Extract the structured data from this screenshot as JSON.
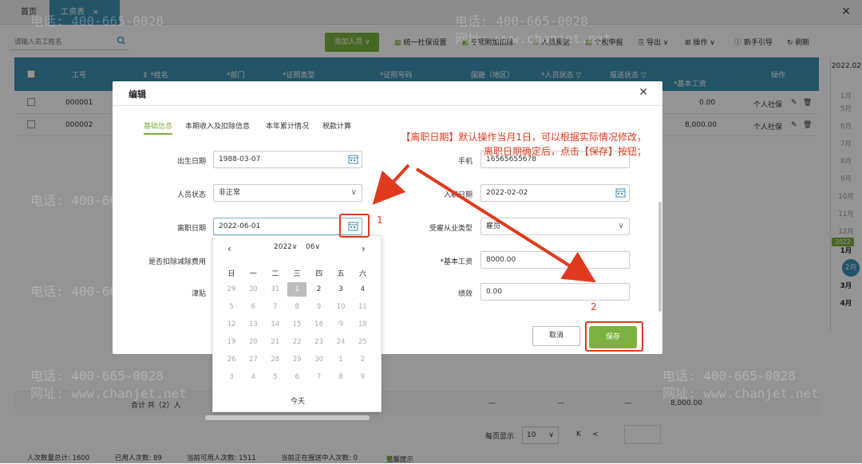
{
  "tabs": {
    "home": "首页",
    "salary": "工资表",
    "close_glyph": "×"
  },
  "toolbar": {
    "search_placeholder": "请输入员工姓名",
    "add_label": "添加人员 ∨",
    "items": [
      "统一社保设置",
      "专项附加扣除",
      "人员报送",
      "个税申报",
      "导出 ∨",
      "操作 ∨",
      "新手引导",
      "刷新"
    ]
  },
  "grid": {
    "headers": [
      "工号",
      "*姓名",
      "*部门",
      "*证照类型",
      "*证照号码",
      "国籍（地区）",
      "*人员状态",
      "报送状态",
      "*基本工资",
      "操作"
    ],
    "rows": [
      {
        "id": "000001",
        "salary": "0.00",
        "op": "个人社保"
      },
      {
        "id": "000002",
        "salary": "8,000.00",
        "op": "个人社保"
      }
    ],
    "total_label": "合计 共（2）人",
    "total_dash": "—",
    "total_salary": "8,000.00"
  },
  "pager": {
    "per_page_label": "每页显示",
    "per_page": "10"
  },
  "status": {
    "total": "人次数量总计: 1600",
    "used": "已用人次数: 89",
    "available": "当前可用人次数: 1511",
    "reporting": "当前正在报送中人次数: 0",
    "warm": "温馨提示"
  },
  "side_calendar": {
    "date": "2022.02",
    "months": [
      "1月",
      "5月",
      "6月",
      "7月",
      "8月",
      "9月",
      "10月",
      "11月",
      "12月"
    ],
    "year_badge": "2022",
    "cur_months": [
      "1月",
      "2月",
      "3月",
      "4月"
    ]
  },
  "dialog": {
    "title": "编辑",
    "tabs": [
      "基础信息",
      "本期收入及扣除信息",
      "本年累计情况",
      "税款计算"
    ],
    "fields": {
      "birth_label": "出生日期",
      "birth_value": "1988-03-07",
      "status_label": "人员状态",
      "status_value": "非正常",
      "leave_label": "离职日期",
      "leave_value": "2022-06-01",
      "deduct_label": "是否扣除减除费用",
      "allowance_label": "津贴",
      "phone_label": "手机",
      "phone_value": "16565655678",
      "join_label": "入职日期",
      "join_value": "2022-02-02",
      "emp_type_label": "受雇从业类型",
      "emp_type_value": "雇员",
      "base_label": "*基本工资",
      "base_value": "8000.00",
      "perf_label": "绩效",
      "perf_value": "0.00"
    },
    "cancel": "取消",
    "save": "保存"
  },
  "picker": {
    "year": "2022",
    "month": "06",
    "weekdays": [
      "日",
      "一",
      "二",
      "三",
      "四",
      "五",
      "六"
    ],
    "weeks": [
      [
        "29",
        "30",
        "31",
        "1",
        "2",
        "3",
        "4"
      ],
      [
        "5",
        "6",
        "7",
        "8",
        "9",
        "10",
        "11"
      ],
      [
        "12",
        "13",
        "14",
        "15",
        "16",
        "今",
        "18"
      ],
      [
        "19",
        "20",
        "21",
        "22",
        "23",
        "24",
        "25"
      ],
      [
        "26",
        "27",
        "28",
        "29",
        "30",
        "1",
        "2"
      ],
      [
        "3",
        "4",
        "5",
        "6",
        "7",
        "8",
        "9"
      ]
    ],
    "today": "今天"
  },
  "annotation": {
    "note_line1": "【离职日期】默认操作当月1日，可以根据实际情况修改，",
    "note_line2": "离职日期确定后，点击【保存】按钮；",
    "n1": "1",
    "n2": "2"
  },
  "watermark": {
    "phone": "电话: 400-665-0028",
    "site": "网址: www.chanjet.net"
  },
  "colors": {
    "accent": "#3c8fb0",
    "green": "#7bb23f",
    "annot_red": "#e03a1e"
  }
}
